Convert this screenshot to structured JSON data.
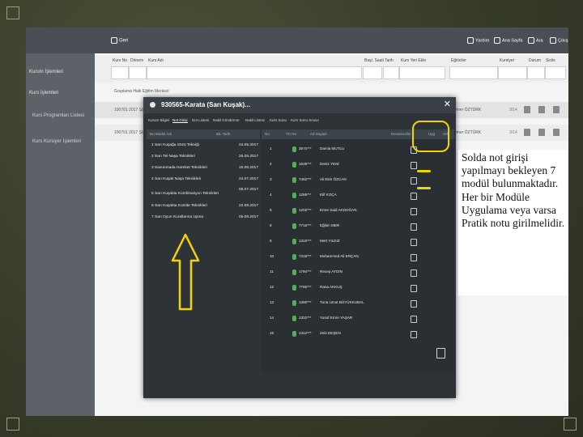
{
  "topbar": {
    "back_label": "Geri",
    "right_items": [
      "Yardım",
      "Ana Sayfa",
      "Ara",
      "Çıkış"
    ]
  },
  "sidebar": {
    "items": [
      {
        "label": "Kurum İşlemleri"
      },
      {
        "label": "Kurs İşlemleri"
      },
      {
        "label": "Kurs Programları Listesi"
      },
      {
        "label": "Kurs Kursiyer İşlemleri"
      }
    ]
  },
  "filters": {
    "labels": [
      "Kurs No",
      "Dönem",
      "Kurs Adı",
      "Başl. Saati",
      "Tarih",
      "Kurs Yeri Ekle",
      "Eğiticiler",
      "Kursiyer",
      "Durum",
      "Sicile"
    ]
  },
  "list": {
    "group_label": "Gruplama Halk Eğitim Merkezi",
    "rows": [
      {
        "left": "100701 2017 Şb",
        "right": "Zahir Ömer ÖZTÜRK",
        "num": "3/14"
      },
      {
        "left": "100701 2017 Şb",
        "right": "Zahir Ömer ÖZTÜRK",
        "num": "3/14"
      }
    ]
  },
  "modal": {
    "title": "930565-Karata (Sarı Kuşak)...",
    "tabs": [
      "Kurum Bilgisi",
      "Not Girişi",
      "Not Listesi",
      "Nakil Gönderme",
      "Nakil Listesi",
      "Kurs Sonu",
      "Kurs Sonu Sınavı"
    ],
    "left_headers": [
      "No Modül Adı",
      "Bit. Tarih"
    ],
    "modules": [
      {
        "name": "1 Sarı Kuşağa Sözü Tekniği",
        "date": "24.05.2017"
      },
      {
        "name": "2 Sarı Tel Naşa Teknikleri",
        "date": "25.05.2017"
      },
      {
        "name": "3 Savunmada Hareket Teknikleri",
        "date": "16.06.2017"
      },
      {
        "name": "4 Sarı Kuşak Naşa Teknikleri",
        "date": "24.07.2017"
      },
      {
        "name": "5 Sarı Kuşakta Kombinasyon Teknikleri",
        "date": "08.07.2017"
      },
      {
        "name": "6 Sarı Kuşakta Kumite Teknikleri",
        "date": "22.08.2017"
      },
      {
        "name": "7 Sarı Oyun Kurallarına Uyma",
        "date": "05.08.2017"
      }
    ],
    "right_headers": [
      "No",
      "TC No",
      "Ad Soyadı",
      "Devamsızlık",
      "Uyg",
      "Ort"
    ],
    "students": [
      {
        "no": "1",
        "tc": "3574***",
        "name": "Damla MUTLU"
      },
      {
        "no": "4",
        "tc": "1528***",
        "name": "Deniz YENİ"
      },
      {
        "no": "3",
        "tc": "7462***",
        "name": "Ali Ekin ÖZCAN"
      },
      {
        "no": "4",
        "tc": "1286***",
        "name": "Elif KOÇA"
      },
      {
        "no": "5",
        "tc": "1202***",
        "name": "Emre Said AKDOĞAN"
      },
      {
        "no": "6",
        "tc": "7718***",
        "name": "Eğitim MER"
      },
      {
        "no": "8",
        "tc": "1318***",
        "name": "Mert YILDIZ"
      },
      {
        "no": "10",
        "tc": "7318***",
        "name": "Muhammed Ali ERÇAN"
      },
      {
        "no": "11",
        "tc": "1794***",
        "name": "Recep AYDIN"
      },
      {
        "no": "12",
        "tc": "7780***",
        "name": "Rana AKKUŞ"
      },
      {
        "no": "13",
        "tc": "1380***",
        "name": "Tuna Umut BÜYÜKKUBAL"
      },
      {
        "no": "14",
        "tc": "1322***",
        "name": "Yusuf Emre YAŞAR"
      },
      {
        "no": "15",
        "tc": "1312***",
        "name": "Zeki DEŞEN"
      }
    ]
  },
  "note": {
    "text": "Solda not girişi yapılmayı bekleyen 7 modül bulunmaktadır. Her bir Modüle Uygulama veya varsa Pratik notu girilmelidir."
  },
  "colors": {
    "highlight": "#f2d400",
    "modal_bg": "#2e3338",
    "topbar_bg": "#4a4f55"
  },
  "icons": [
    "back-icon",
    "help-icon",
    "home-icon",
    "search-icon",
    "logout-icon",
    "close-icon",
    "save-icon",
    "checkbox-icon",
    "user-icon",
    "up-arrow-icon"
  ]
}
